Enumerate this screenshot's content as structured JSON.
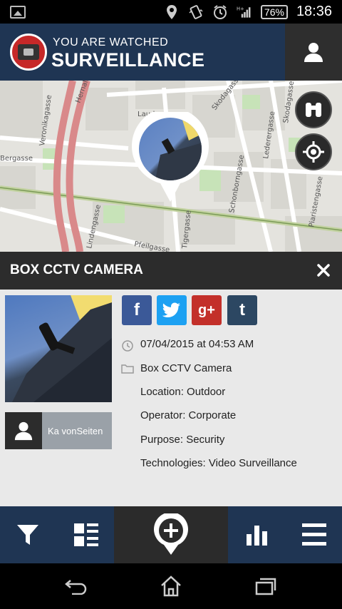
{
  "statusbar": {
    "battery": "76%",
    "time": "18:36",
    "icons": [
      "image-icon",
      "location-pin-icon",
      "vibrate-icon",
      "alarm-icon",
      "signal-hplus-icon",
      "battery-icon"
    ]
  },
  "header": {
    "tagline": "YOU ARE WATCHED",
    "title": "SURVEILLANCE",
    "profile_icon": "user-icon"
  },
  "map": {
    "street_labels": [
      "Veronikagasse",
      "Hernalser",
      "Laudongasse",
      "Skodagasse",
      "Lederergasse",
      "Skodagasse",
      "Schonborngasse",
      "Pfeilgasse",
      "Tigergasse",
      "Piaristengasse",
      "Bergasse",
      "Lindengasse"
    ],
    "buttons": [
      "binoculars-icon",
      "locate-icon"
    ]
  },
  "detail": {
    "title": "BOX CCTV CAMERA",
    "operator_name": "Ka vonSeiten",
    "share": [
      "f",
      "twitter",
      "g+",
      "t"
    ],
    "date": "07/04/2015 at 04:53 AM",
    "category": "Box CCTV Camera",
    "location": "Location: Outdoor",
    "operator": "Operator: Corporate",
    "purpose": "Purpose: Security",
    "technologies": "Technologies: Video Surveillance"
  },
  "toolbar": {
    "items": [
      "filter-icon",
      "list-icon",
      "add-pin-icon",
      "bar-chart-icon",
      "menu-icon"
    ]
  },
  "colors": {
    "header_bg": "#1f3553",
    "dark": "#2c2c2c",
    "facebook": "#3b5998",
    "twitter": "#1da1f2",
    "googleplus": "#c3302a",
    "tumblr": "#2c4762"
  }
}
